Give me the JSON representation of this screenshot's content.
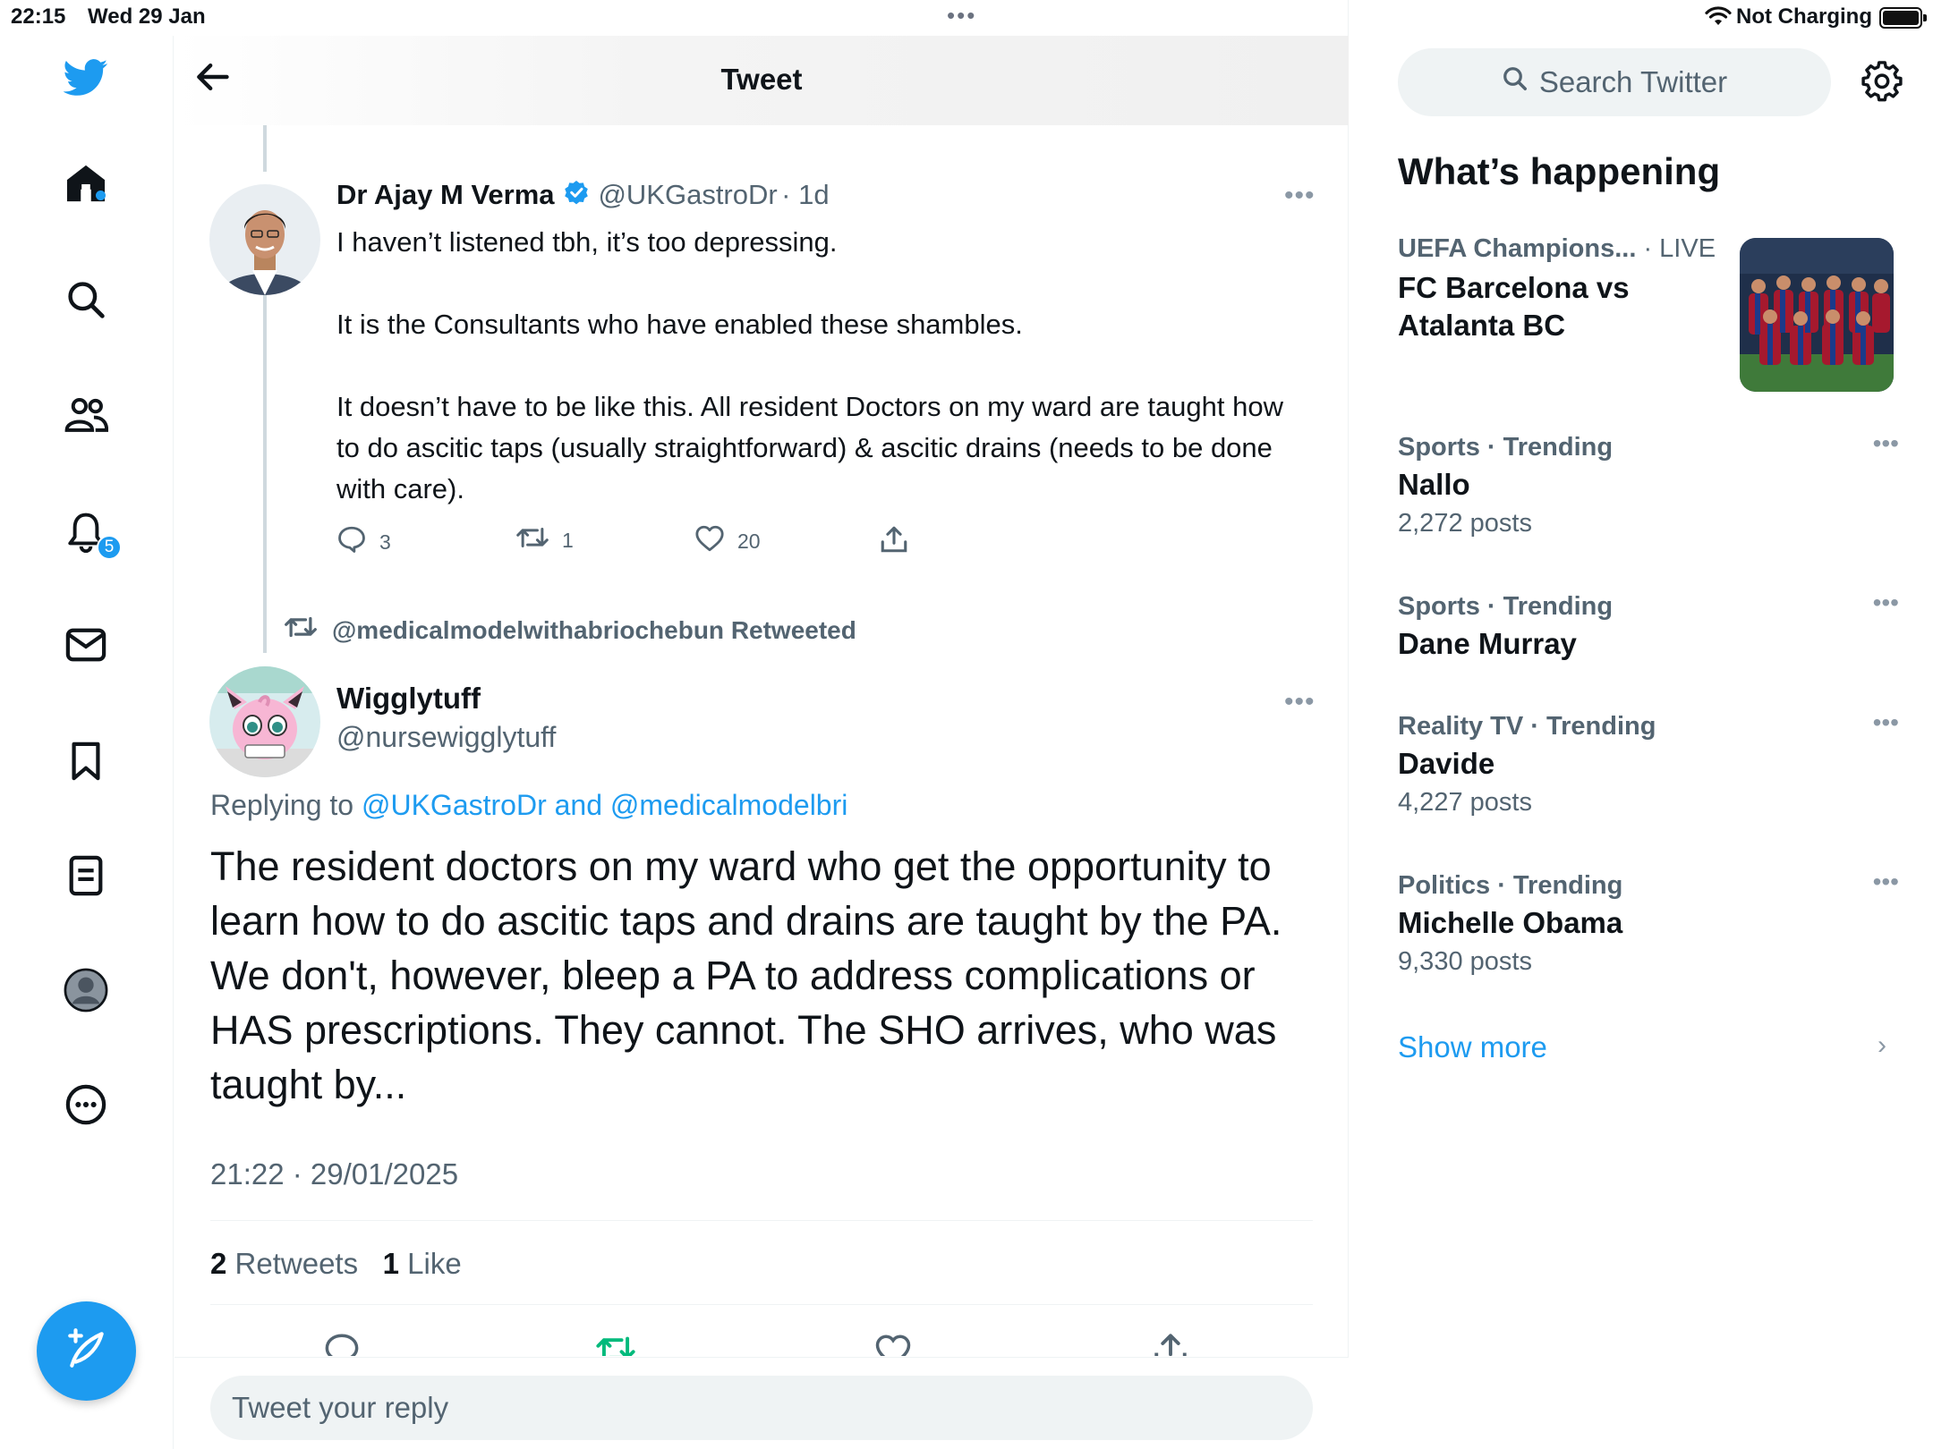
{
  "status_bar": {
    "time": "22:15",
    "date": "Wed 29 Jan",
    "dots": "•••",
    "charging": "Not Charging"
  },
  "nav": {
    "notification_count": "5",
    "icons": [
      "twitter-logo-icon",
      "home-icon",
      "search-icon",
      "communities-icon",
      "notifications-icon",
      "messages-icon",
      "bookmarks-icon",
      "lists-icon",
      "profile-icon",
      "more-icon",
      "compose-icon"
    ]
  },
  "header": {
    "title": "Tweet"
  },
  "tweet1": {
    "name": "Dr Ajay M Verma",
    "handle": "@UKGastroDr",
    "time": "· 1d",
    "more": "•••",
    "paragraphs": [
      "I haven’t listened tbh, it’s too depressing.",
      "It is the Consultants who have enabled these shambles.",
      "It doesn’t have to be like this. All resident Doctors on my ward are taught how to do ascitic taps (usually straightforward) & ascitic drains (needs to be done with care)."
    ],
    "replies": "3",
    "retweets": "1",
    "likes": "20"
  },
  "retweet_banner": {
    "text": "@medicalmodelwithabriochebun Retweeted"
  },
  "tweet2": {
    "name": "Wigglytuff",
    "handle": "@nursewigglytuff",
    "more": "•••",
    "replying_prefix": "Replying to ",
    "replying_user1": "@UKGastroDr",
    "replying_and": " and ",
    "replying_user2": "@medicalmodelbri",
    "body": "The resident doctors on my ward who get the opportunity to learn how to do ascitic taps and drains are taught by the PA. We don't, however, bleep a PA to address complications or HAS prescriptions. They cannot. The SHO arrives, who was taught by...",
    "timestamp": "21:22 · 29/01/2025",
    "retweet_count": "2",
    "retweet_label": "Retweets",
    "like_count": "1",
    "like_label": "Like"
  },
  "reply": {
    "placeholder": "Tweet your reply"
  },
  "sidebar": {
    "search_placeholder": "Search Twitter",
    "section_title": "What’s happening",
    "live_event": {
      "category": "UEFA Champions...",
      "status": "· LIVE",
      "title": "FC Barcelona vs Atalanta BC"
    },
    "trends": [
      {
        "meta": "Sports · Trending",
        "name": "Nallo",
        "count": "2,272 posts"
      },
      {
        "meta": "Sports · Trending",
        "name": "Dane Murray",
        "count": ""
      },
      {
        "meta": "Reality TV · Trending",
        "name": "Davide",
        "count": "4,227 posts"
      },
      {
        "meta": "Politics · Trending",
        "name": "Michelle Obama",
        "count": "9,330 posts"
      }
    ],
    "trend_more": "•••",
    "show_more": "Show more",
    "show_more_chevron": "›"
  },
  "colors": {
    "accent": "#1d9bf0",
    "secondary_text": "#536471",
    "retweet_green": "#00ba7c"
  }
}
